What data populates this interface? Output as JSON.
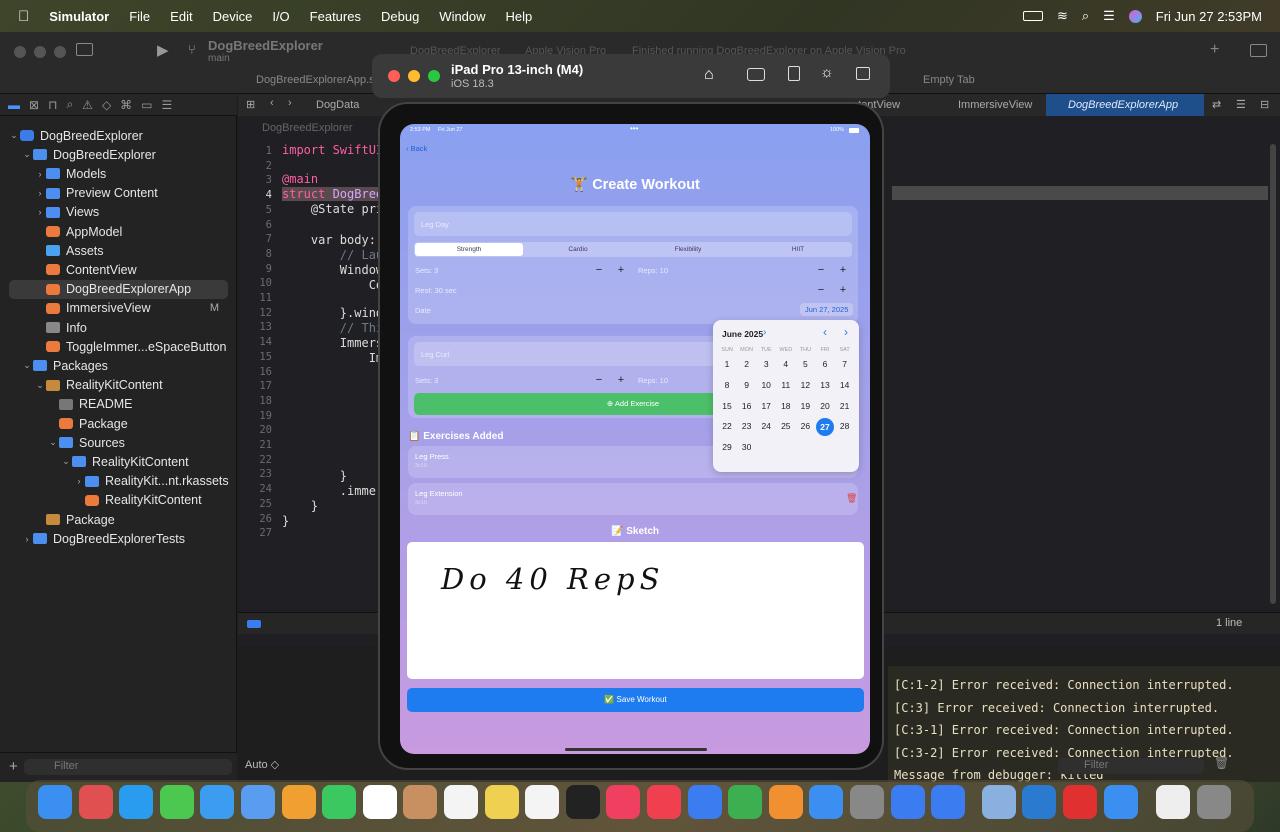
{
  "menubar": {
    "app": "Simulator",
    "items": [
      "File",
      "Edit",
      "Device",
      "I/O",
      "Features",
      "Debug",
      "Window",
      "Help"
    ],
    "datetime": "Fri Jun 27  2:53PM"
  },
  "xcode": {
    "scheme": "DogBreedExplorer",
    "branch": "main",
    "activity_tab1": "DogBreedExplorer",
    "activity_tab2": "Apple Vision Pro",
    "activity_status": "Finished running DogBreedExplorer on Apple Vision Pro",
    "file_tab": "DogBreedExplorerApp.sw",
    "empty_tab": "Empty Tab",
    "breadcrumb_data": "DogData",
    "jump_tabs": [
      "ntentView",
      "ImmersiveView",
      "DogBreedExplorerApp"
    ],
    "path": "DogBreedExplorer",
    "filter_placeholder": "Filter",
    "auto_label": "Auto ◇",
    "line_count": "1 line",
    "console_filter": "Filter"
  },
  "tree": [
    {
      "label": "DogBreedExplorer",
      "icon": "proj",
      "indent": 0,
      "chev": "⌄"
    },
    {
      "label": "DogBreedExplorer",
      "icon": "folder",
      "indent": 1,
      "chev": "⌄"
    },
    {
      "label": "Models",
      "icon": "folder",
      "indent": 2,
      "chev": "›"
    },
    {
      "label": "Preview Content",
      "icon": "folder",
      "indent": 2,
      "chev": "›"
    },
    {
      "label": "Views",
      "icon": "folder",
      "indent": 2,
      "chev": "›"
    },
    {
      "label": "AppModel",
      "icon": "swift",
      "indent": 2,
      "chev": ""
    },
    {
      "label": "Assets",
      "icon": "asset",
      "indent": 2,
      "chev": ""
    },
    {
      "label": "ContentView",
      "icon": "swift",
      "indent": 2,
      "chev": ""
    },
    {
      "label": "DogBreedExplorerApp",
      "icon": "swift",
      "indent": 2,
      "chev": "",
      "selected": true
    },
    {
      "label": "ImmersiveView",
      "icon": "swift",
      "indent": 2,
      "chev": "",
      "badge": "M"
    },
    {
      "label": "Info",
      "icon": "plist",
      "indent": 2,
      "chev": ""
    },
    {
      "label": "ToggleImmer...eSpaceButton",
      "icon": "swift",
      "indent": 2,
      "chev": ""
    },
    {
      "label": "Packages",
      "icon": "folder",
      "indent": 1,
      "chev": "⌄"
    },
    {
      "label": "RealityKitContent",
      "icon": "pkg",
      "indent": 2,
      "chev": "⌄"
    },
    {
      "label": "README",
      "icon": "doc",
      "indent": 3,
      "chev": ""
    },
    {
      "label": "Package",
      "icon": "swift",
      "indent": 3,
      "chev": ""
    },
    {
      "label": "Sources",
      "icon": "folder",
      "indent": 3,
      "chev": "⌄"
    },
    {
      "label": "RealityKitContent",
      "icon": "folder",
      "indent": 4,
      "chev": "⌄"
    },
    {
      "label": "RealityKit...nt.rkassets",
      "icon": "folder",
      "indent": 5,
      "chev": "›"
    },
    {
      "label": "RealityKitContent",
      "icon": "swift",
      "indent": 5,
      "chev": ""
    },
    {
      "label": "Package",
      "icon": "pkg",
      "indent": 2,
      "chev": ""
    },
    {
      "label": "DogBreedExplorerTests",
      "icon": "folder",
      "indent": 1,
      "chev": "›"
    }
  ],
  "code_lines": [
    "1",
    "2",
    "3",
    "4",
    "5",
    "6",
    "7",
    "8",
    "9",
    "10",
    "11",
    "12",
    "13",
    "14",
    "15",
    "16",
    "17",
    "18",
    "19",
    "20",
    "21",
    "22",
    "23",
    "24",
    "25",
    "26",
    "27"
  ],
  "code": {
    "l1": "import SwiftUI",
    "l3": "@main",
    "l4a": "struct ",
    "l4b": "DogBreed",
    "l5": "    @State priv",
    "l7": "    var body: s",
    "l8": "        // Laun",
    "l9": "        WindowG",
    "l10": "            Con",
    "l12": "        }.windo",
    "l13": "        // This",
    "l14": "        Immersi",
    "l15": "            Imm",
    "l23": "        }",
    "l24": "        .immers",
    "l25": "    }",
    "l26": "}"
  },
  "console": [
    "[C:1-2] Error received: Connection interrupted.",
    "[C:3] Error received: Connection interrupted.",
    "[C:3-1] Error received: Connection interrupted.",
    "[C:3-2] Error received: Connection interrupted.",
    "Message from debugger: killed"
  ],
  "simulator": {
    "device": "iPad Pro 13-inch (M4)",
    "os": "iOS 18.3"
  },
  "ipad": {
    "status_time": "2:53 PM",
    "status_date": "Fri Jun 27",
    "battery": "100%",
    "back": "Back",
    "title": "🏋️ Create Workout",
    "workout_name": "Leg Day",
    "categories": [
      "Strength",
      "Cardio",
      "Flexibility",
      "HIIT"
    ],
    "sets": "Sets: 3",
    "reps": "Reps: 10",
    "rest": "Rest: 30 sec",
    "date_label": "Date",
    "date_value": "Jun 27, 2025",
    "exercise_name": "Leg Curl",
    "sets2": "Sets: 3",
    "reps2": "Reps: 10",
    "add_exercise": "Add Exercise",
    "exercises_header": "📋 Exercises Added",
    "exercises": [
      {
        "name": "Leg Press",
        "detail": "3x10"
      },
      {
        "name": "Leg Extension",
        "detail": "3x10"
      }
    ],
    "sketch_header": "📝 Sketch",
    "sketch_text": "Do 40 RepS",
    "save": "✅ Save Workout"
  },
  "calendar": {
    "month": "June 2025",
    "weekdays": [
      "SUN",
      "MON",
      "TUE",
      "WED",
      "THU",
      "FRI",
      "SAT"
    ],
    "days": [
      "1",
      "2",
      "3",
      "4",
      "5",
      "6",
      "7",
      "8",
      "9",
      "10",
      "11",
      "12",
      "13",
      "14",
      "15",
      "16",
      "17",
      "18",
      "19",
      "20",
      "21",
      "22",
      "23",
      "24",
      "25",
      "26",
      "27",
      "28",
      "29",
      "30"
    ],
    "selected": "27"
  },
  "colors": {
    "accent": "#1e7bf0",
    "green": "#4cbf6a",
    "selected_day": "#1e7bf0"
  }
}
